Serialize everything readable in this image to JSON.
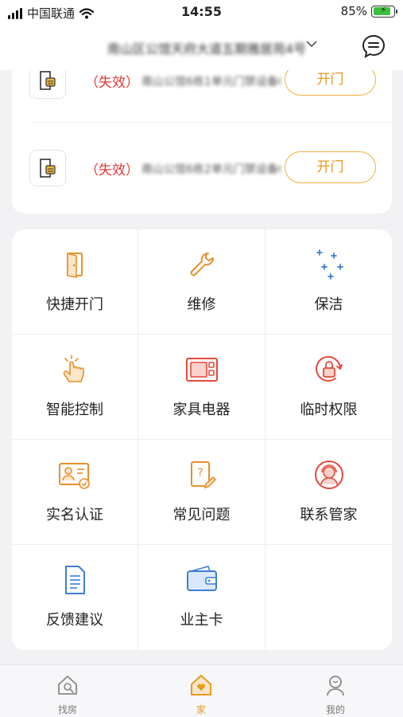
{
  "status_bar": {
    "carrier": "中国联通",
    "time": "14:55",
    "battery": "85%",
    "battery_level": 0.85
  },
  "header": {
    "title": "南山区公馆天府大道五期雅居苑4号楼",
    "dropdown_icon": "chevron-down-icon",
    "message_icon": "chat-bubble-icon"
  },
  "doors": [
    {
      "status": "（失效）",
      "name": "南山公馆6栋1单元门禁设备01",
      "button": "开门"
    },
    {
      "status": "（失效）",
      "name": "南山公馆6栋2单元门禁设备02",
      "button": "开门"
    }
  ],
  "services": [
    {
      "label": "快捷开门",
      "icon": "door-icon"
    },
    {
      "label": "维修",
      "icon": "wrench-icon"
    },
    {
      "label": "保洁",
      "icon": "sparkle-icon"
    },
    {
      "label": "智能控制",
      "icon": "tap-hand-icon"
    },
    {
      "label": "家具电器",
      "icon": "microwave-icon"
    },
    {
      "label": "临时权限",
      "icon": "lock-refresh-icon"
    },
    {
      "label": "实名认证",
      "icon": "id-card-icon"
    },
    {
      "label": "常见问题",
      "icon": "question-doc-icon"
    },
    {
      "label": "联系管家",
      "icon": "butler-icon"
    },
    {
      "label": "反馈建议",
      "icon": "feedback-doc-icon"
    },
    {
      "label": "业主卡",
      "icon": "wallet-card-icon"
    },
    {
      "label": "",
      "icon": ""
    }
  ],
  "tabs": [
    {
      "label": "找房",
      "icon": "house-search-icon",
      "active": false
    },
    {
      "label": "家",
      "icon": "home-heart-icon",
      "active": true
    },
    {
      "label": "我的",
      "icon": "person-icon",
      "active": false
    }
  ],
  "colors": {
    "accent": "#e79a1e",
    "invalid": "#e5393a",
    "background": "#f2f2f5"
  }
}
